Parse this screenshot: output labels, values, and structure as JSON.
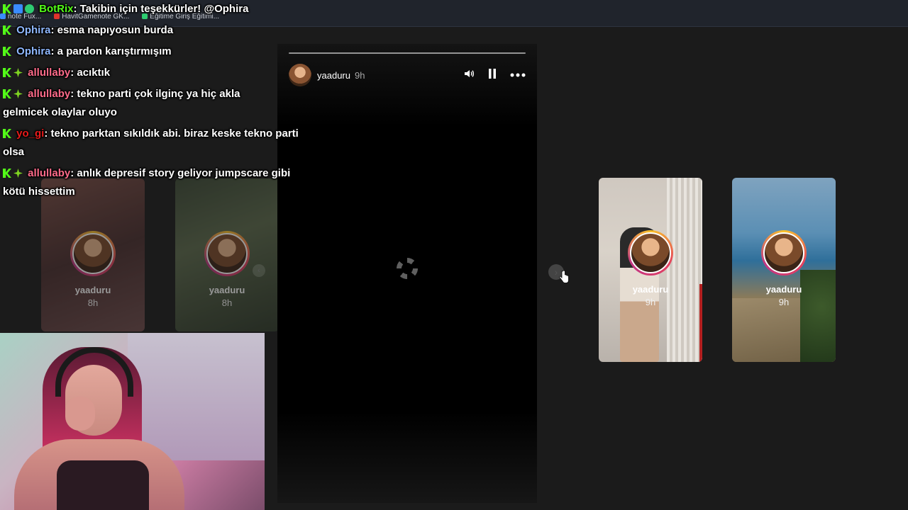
{
  "browser": {
    "bookmarks": [
      {
        "label": "note Fux...",
        "color": "#3a8bff"
      },
      {
        "label": "HavitGamenote GK...",
        "color": "#e0342c"
      },
      {
        "label": "Eğitime Giriş Eğitimi...",
        "color": "#2ecc71"
      }
    ]
  },
  "story_viewer": {
    "username": "yaaduru",
    "time": "9h",
    "icons": {
      "mute": "volume-icon",
      "pause": "pause-icon",
      "more": "more-icon"
    }
  },
  "thumbnails": [
    {
      "username": "yaaduru",
      "age": "8h"
    },
    {
      "username": "yaaduru",
      "age": "8h"
    },
    {
      "username": "yaaduru",
      "age": "9h"
    },
    {
      "username": "yaaduru",
      "age": "9h"
    }
  ],
  "chat": [
    {
      "user": "BotRix",
      "text": ": Takibin için teşekkürler! @Ophira",
      "badges": [
        "k",
        "mod",
        "check"
      ]
    },
    {
      "user": "Ophira",
      "text": ": esma napıyosun burda",
      "badges": [
        "k"
      ]
    },
    {
      "user": "Ophira",
      "text": ": a pardon karıştırmışım",
      "badges": [
        "k"
      ]
    },
    {
      "user": "allullaby",
      "text": ": acıktık",
      "badges": [
        "k",
        "spark"
      ]
    },
    {
      "user": "allullaby",
      "text": ": tekno parti çok ilginç ya hiç akla gelmicek olaylar oluyo",
      "badges": [
        "k",
        "spark"
      ]
    },
    {
      "user": "yo_gi",
      "text": ": tekno parktan sıkıldık abi. biraz keske tekno parti olsa",
      "badges": [
        "k"
      ]
    },
    {
      "user": "allullaby",
      "text": ": anlık depresif story geliyor jumpscare gibi kötü hissettim",
      "badges": [
        "k",
        "spark"
      ]
    }
  ],
  "colors": {
    "botrix": "#53fc18",
    "ophira": "#8fb8ff",
    "allullaby": "#ff6b8a",
    "yo_gi": "#e81b1b"
  }
}
